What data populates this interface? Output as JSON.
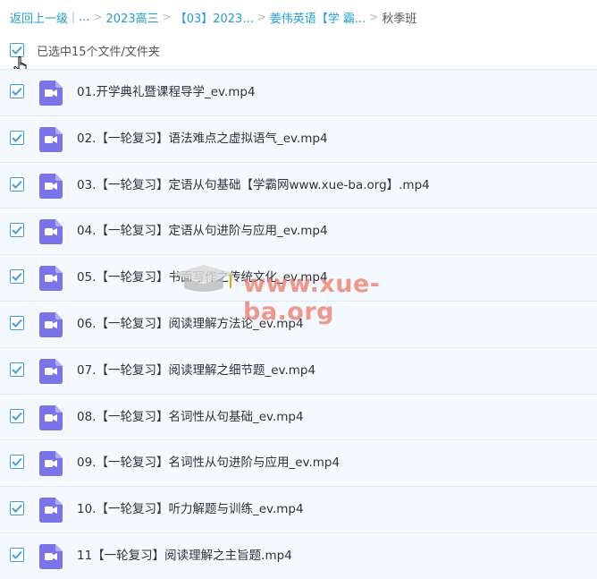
{
  "breadcrumb": {
    "back": "返回上一级",
    "ellipsis": "...",
    "items": [
      "2023高三",
      "【03】2023...",
      "姜伟英语【学 霸..."
    ],
    "current": "秋季班"
  },
  "selection": {
    "label": "已选中15个文件/文件夹",
    "checked": true
  },
  "files": [
    {
      "name": "01.开学典礼暨课程导学_ev.mp4",
      "checked": true
    },
    {
      "name": "02.【一轮复习】语法难点之虚拟语气_ev.mp4",
      "checked": true
    },
    {
      "name": "03.【一轮复习】定语从句基础【学霸网www.xue-ba.org】.mp4",
      "checked": true
    },
    {
      "name": "04.【一轮复习】定语从句进阶与应用_ev.mp4",
      "checked": true
    },
    {
      "name": "05.【一轮复习】书面写作之传统文化_ev.mp4",
      "checked": true
    },
    {
      "name": "06.【一轮复习】阅读理解方法论_ev.mp4",
      "checked": true
    },
    {
      "name": "07.【一轮复习】阅读理解之细节题_ev.mp4",
      "checked": true
    },
    {
      "name": "08.【一轮复习】名词性从句基础_ev.mp4",
      "checked": true
    },
    {
      "name": "09.【一轮复习】名词性从句进阶与应用_ev.mp4",
      "checked": true
    },
    {
      "name": "10.【一轮复习】听力解题与训练_ev.mp4",
      "checked": true
    },
    {
      "name": "11【一轮复习】阅读理解之主旨题.mp4",
      "checked": true
    }
  ],
  "watermark": "www.xue-ba.org",
  "colors": {
    "link": "#1e9cd7",
    "checkbox": "#3f9fde",
    "video_icon": "#7a74e8",
    "row_bg": "#f3f9fe",
    "watermark": "#ef6f5b"
  },
  "icons": {
    "file": "video-file-icon",
    "check": "checkmark-icon",
    "cursor": "hand-pointer-icon"
  }
}
